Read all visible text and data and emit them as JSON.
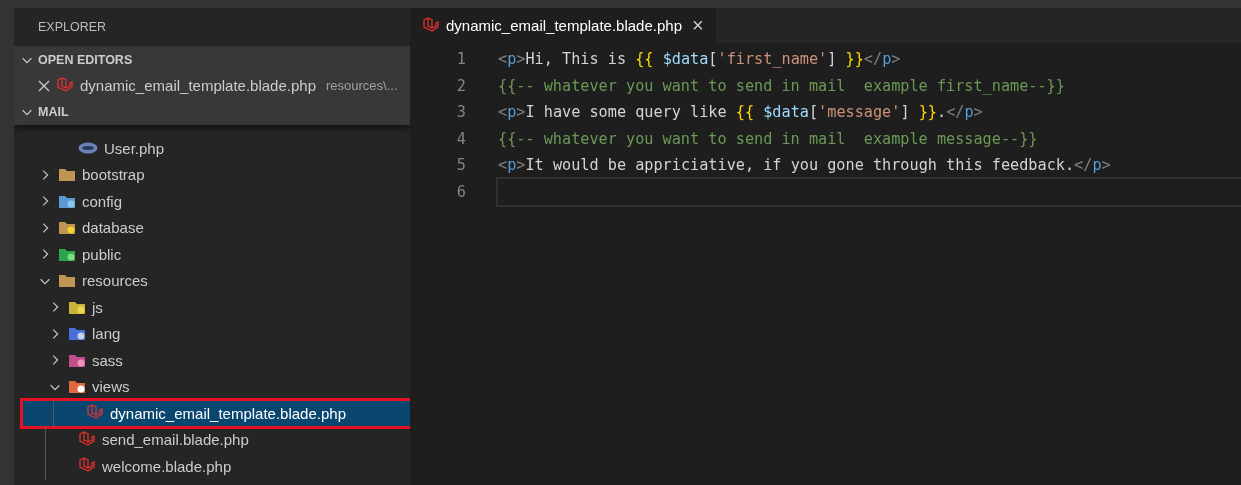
{
  "sidebar": {
    "title": "EXPLORER",
    "open_editors": {
      "label": "OPEN EDITORS",
      "expanded": true,
      "items": [
        {
          "name": "dynamic_email_template.blade.php",
          "path": "resources\\...",
          "kind": "laravel"
        }
      ]
    },
    "folder": {
      "label": "MAIL",
      "expanded": true,
      "items": [
        {
          "children": [
            {
              "name": "User.php",
              "kind": "php",
              "selected": false
            }
          ]
        },
        {
          "name": "bootstrap",
          "kind": "folder",
          "expanded": false
        },
        {
          "name": "config",
          "kind": "config",
          "expanded": false
        },
        {
          "name": "database",
          "kind": "database",
          "expanded": false
        },
        {
          "name": "public",
          "kind": "public",
          "expanded": false
        },
        {
          "name": "resources",
          "kind": "folder",
          "expanded": true,
          "children": [
            {
              "name": "js",
              "kind": "js",
              "expanded": false
            },
            {
              "name": "lang",
              "kind": "lang",
              "expanded": false
            },
            {
              "name": "sass",
              "kind": "sass",
              "expanded": false
            },
            {
              "name": "views",
              "kind": "views",
              "expanded": true,
              "children": [
                {
                  "name": "dynamic_email_template.blade.php",
                  "kind": "laravel",
                  "selected": true,
                  "highlighted": true
                },
                {
                  "name": "send_email.blade.php",
                  "kind": "laravel",
                  "selected": false,
                  "highlighted": false
                },
                {
                  "name": "welcome.blade.php",
                  "kind": "laravel",
                  "selected": false,
                  "highlighted": false
                }
              ]
            }
          ]
        }
      ]
    }
  },
  "editor": {
    "tabs": [
      {
        "label": "dynamic_email_template.blade.php",
        "kind": "laravel",
        "selected": true,
        "close": "×"
      }
    ],
    "lines": [
      {
        "number": "1",
        "current": false,
        "tokens": [
          {
            "kind": "bracket",
            "text": "<"
          },
          {
            "kind": "tag",
            "text": "p"
          },
          {
            "kind": "bracket",
            "text": ">"
          },
          {
            "kind": "text",
            "text": "Hi, This is "
          },
          {
            "kind": "brace",
            "text": "{{ "
          },
          {
            "kind": "var",
            "text": "$data"
          },
          {
            "kind": "punct",
            "text": "["
          },
          {
            "kind": "string",
            "text": "'first_name'"
          },
          {
            "kind": "punct",
            "text": "] "
          },
          {
            "kind": "brace",
            "text": "}}"
          },
          {
            "kind": "bracket",
            "text": "</"
          },
          {
            "kind": "tag",
            "text": "p"
          },
          {
            "kind": "bracket",
            "text": ">"
          }
        ]
      },
      {
        "number": "2",
        "current": false,
        "tokens": [
          {
            "kind": "comment",
            "text": "{{-- whatever you want to send in mail  example first_name--}}"
          }
        ]
      },
      {
        "number": "3",
        "current": false,
        "tokens": [
          {
            "kind": "bracket",
            "text": "<"
          },
          {
            "kind": "tag",
            "text": "p"
          },
          {
            "kind": "bracket",
            "text": ">"
          },
          {
            "kind": "text",
            "text": "I have some query like "
          },
          {
            "kind": "brace",
            "text": "{{ "
          },
          {
            "kind": "var",
            "text": "$data"
          },
          {
            "kind": "punct",
            "text": "["
          },
          {
            "kind": "string",
            "text": "'message'"
          },
          {
            "kind": "punct",
            "text": "] "
          },
          {
            "kind": "brace",
            "text": "}}"
          },
          {
            "kind": "text",
            "text": "."
          },
          {
            "kind": "bracket",
            "text": "</"
          },
          {
            "kind": "tag",
            "text": "p"
          },
          {
            "kind": "bracket",
            "text": ">"
          }
        ]
      },
      {
        "number": "4",
        "current": false,
        "tokens": [
          {
            "kind": "comment",
            "text": "{{-- whatever you want to send in mail  example message--}}"
          }
        ]
      },
      {
        "number": "5",
        "current": false,
        "tokens": [
          {
            "kind": "bracket",
            "text": "<"
          },
          {
            "kind": "tag",
            "text": "p"
          },
          {
            "kind": "bracket",
            "text": ">"
          },
          {
            "kind": "text",
            "text": "It would be appriciative, if you gone through this feedback."
          },
          {
            "kind": "bracket",
            "text": "</"
          },
          {
            "kind": "tag",
            "text": "p"
          },
          {
            "kind": "bracket",
            "text": ">"
          }
        ]
      },
      {
        "number": "6",
        "current": true
      }
    ]
  }
}
